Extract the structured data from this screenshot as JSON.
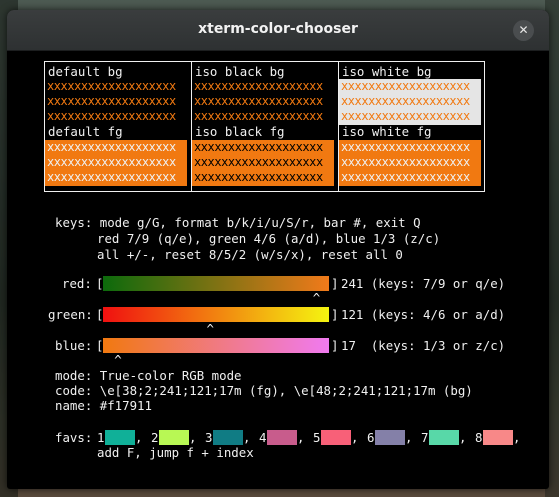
{
  "window": {
    "title": "xterm-color-chooser"
  },
  "grid": {
    "sample_text": "xxxxxxxxxxxxxxxxxxx",
    "cells": [
      {
        "label": "default bg",
        "fg": "#f17911",
        "bg": "#000000"
      },
      {
        "label": "iso black bg",
        "fg": "#f17911",
        "bg": "#000000"
      },
      {
        "label": "iso white bg",
        "fg": "#f17911",
        "bg": "#e5e5e5"
      },
      {
        "label": "default fg",
        "fg": "#f0f0f0",
        "bg": "#f17911"
      },
      {
        "label": "iso black fg",
        "fg": "#000000",
        "bg": "#f17911"
      },
      {
        "label": "iso white fg",
        "fg": "#f0f0f0",
        "bg": "#f17911"
      }
    ]
  },
  "keys": {
    "line1": "keys: mode g/G, format b/k/i/u/S/r, bar #, exit Q",
    "line2": "red 7/9 (q/e), green 4/6 (a/d), blue 1/3 (z/c)",
    "line3": "all +/-, reset 8/5/2 (w/s/x), reset all 0"
  },
  "sliders": [
    {
      "label": "red:",
      "value_text": "241 (keys: 7/9 or q/e)",
      "value": 241,
      "max": 255,
      "from": "#0c6a0c",
      "to": "#f17a1a"
    },
    {
      "label": "green:",
      "value_text": "121 (keys: 4/6 or a/d)",
      "value": 121,
      "max": 255,
      "from": "#f01010",
      "to": "#f4f510"
    },
    {
      "label": "blue:",
      "value_text": "17  (keys: 1/3 or z/c)",
      "value": 17,
      "max": 255,
      "from": "#f17910",
      "to": "#f07af0"
    }
  ],
  "bracket_open": "[",
  "bracket_close": "]",
  "caret": "^",
  "info": {
    "mode": "mode: True-color RGB mode",
    "code": "code: \\e[38;2;241;121;17m (fg), \\e[48;2;241;121;17m (bg)",
    "name": "name: #f17911"
  },
  "favs": {
    "label": "favs:",
    "items": [
      {
        "index": "1",
        "color": "#10b098"
      },
      {
        "index": "2",
        "color": "#b8f854"
      },
      {
        "index": "3",
        "color": "#107c84"
      },
      {
        "index": "4",
        "color": "#c85c8c"
      },
      {
        "index": "5",
        "color": "#f86078"
      },
      {
        "index": "6",
        "color": "#8480a8"
      },
      {
        "index": "7",
        "color": "#58d8a8"
      },
      {
        "index": "8",
        "color": "#f88888"
      }
    ],
    "separator": ",",
    "footer": "add F, jump f + index"
  }
}
